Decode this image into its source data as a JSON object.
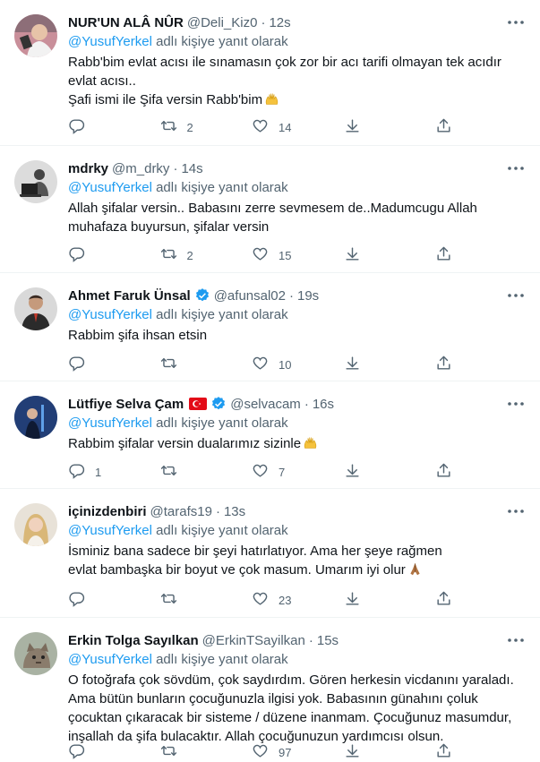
{
  "reply_prefix": "adlı kişiye yanıt olarak",
  "colors": {
    "accent": "#1d9bf0",
    "secondary": "#536471",
    "text": "#0f1419",
    "divider": "#eff3f4"
  },
  "tweets": [
    {
      "name": "NUR'UN ALÂ NÛR",
      "handle": "@Deli_Kiz0",
      "time": "12s",
      "mention": "@YusufYerkel",
      "lines": [
        "Rabb'bim evlat acısı ile sınamasın çok zor bir acı tarifi olmayan tek acıdır evlat acısı..",
        "Şafi ismi ile Şifa versin Rabb'bim"
      ],
      "emoji": "raising-hands",
      "replies": "",
      "retweets": "2",
      "likes": "14"
    },
    {
      "name": "mdrky",
      "handle": "@m_drky",
      "time": "14s",
      "mention": "@YusufYerkel",
      "lines": [
        "Allah şifalar versin.. Babasını zerre sevmesem de..Madumcugu Allah muhafaza buyursun, şifalar versin"
      ],
      "replies": "",
      "retweets": "2",
      "likes": "15"
    },
    {
      "name": "Ahmet Faruk Ünsal",
      "handle": "@afunsal02",
      "time": "19s",
      "verified": true,
      "mention": "@YusufYerkel",
      "lines": [
        "Rabbim şifa ihsan etsin"
      ],
      "replies": "",
      "retweets": "",
      "likes": "10"
    },
    {
      "name": "Lütfiye Selva Çam",
      "handle": "@selvacam",
      "time": "16s",
      "verified": true,
      "flag": "turkey-flag",
      "mention": "@YusufYerkel",
      "lines": [
        "Rabbim şifalar versin dualarımız sizinle"
      ],
      "emoji": "raising-hands",
      "replies": "1",
      "retweets": "",
      "likes": "7"
    },
    {
      "name": "içinizdenbiri",
      "handle": "@tarafs19",
      "time": "13s",
      "mention": "@YusufYerkel",
      "lines": [
        "İsminiz bana sadece bir şeyi hatırlatıyor. Ama her şeye rağmen evlat bambaşka bir boyut ve çok masum. Umarım iyi olur"
      ],
      "emoji": "folded-hands",
      "replies": "",
      "retweets": "",
      "likes": "23"
    },
    {
      "name": "Erkin Tolga Sayılkan",
      "handle": "@ErkinTSayilkan",
      "time": "15s",
      "mention": "@YusufYerkel",
      "lines": [
        "O fotoğrafa çok sövdüm, çok saydırdım. Gören herkesin vicdanını yaraladı. Ama bütün bunların çocuğunuzla ilgisi yok. Babasının günahını çoluk çocuktan çıkaracak bir sisteme / düzene inanmam. Çocuğunuz masumdur, inşallah da şifa bulacaktır. Allah çocuğunuzun yardımcısı olsun."
      ],
      "replies": "",
      "retweets": "",
      "likes": "97"
    }
  ]
}
